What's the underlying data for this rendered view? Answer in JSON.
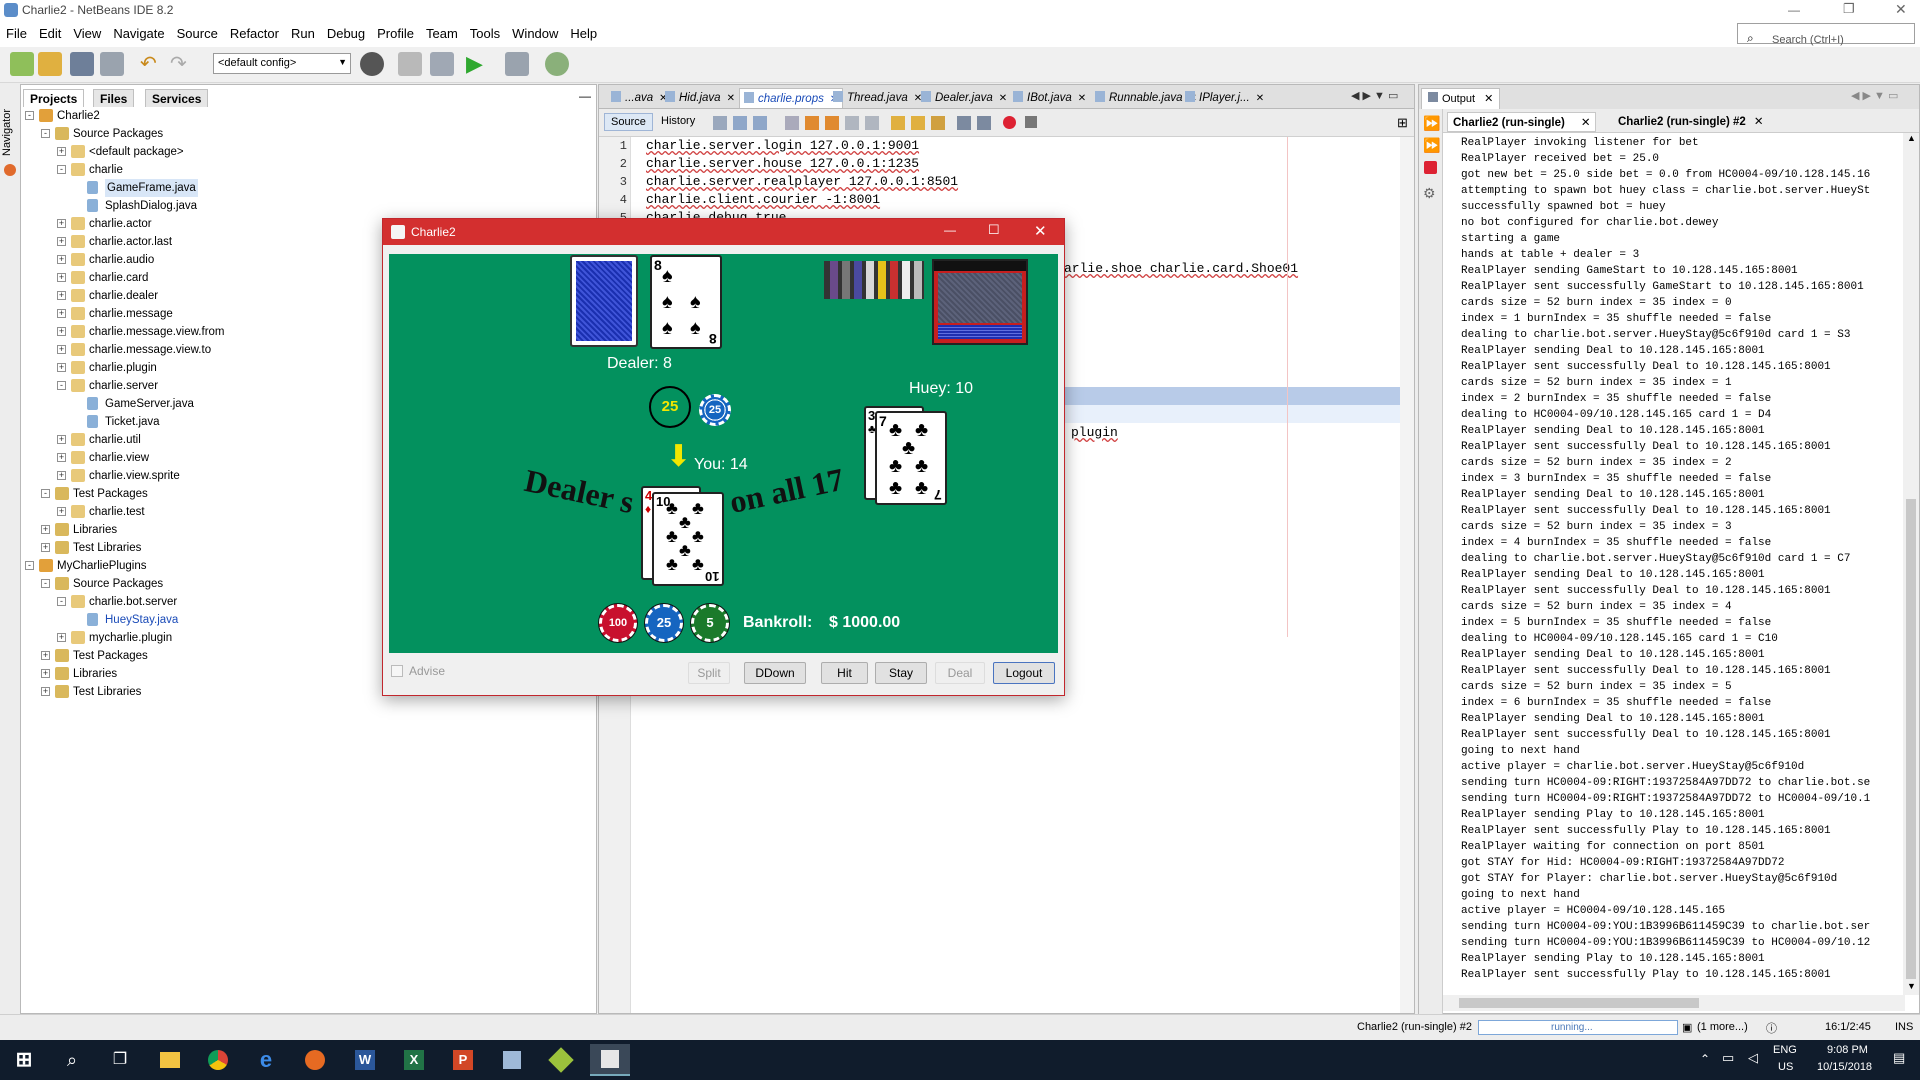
{
  "window": {
    "title": "Charlie2 - NetBeans IDE 8.2"
  },
  "search": {
    "placeholder": "Search (Ctrl+I)"
  },
  "menu": [
    "File",
    "Edit",
    "View",
    "Navigate",
    "Source",
    "Refactor",
    "Run",
    "Debug",
    "Profile",
    "Team",
    "Tools",
    "Window",
    "Help"
  ],
  "toolbar": {
    "config": "<default config>"
  },
  "navigator_label": "Navigator",
  "projects": {
    "tabs": [
      "Projects",
      "Files",
      "Services"
    ],
    "tree": [
      {
        "label": "Charlie2",
        "level": 0,
        "kind": "project",
        "exp": "-"
      },
      {
        "label": "Source Packages",
        "level": 1,
        "kind": "folder",
        "exp": "-"
      },
      {
        "label": "<default package>",
        "level": 2,
        "kind": "pkg",
        "exp": "+"
      },
      {
        "label": "charlie",
        "level": 2,
        "kind": "pkg",
        "exp": "-"
      },
      {
        "label": "GameFrame.java",
        "level": 3,
        "kind": "java",
        "exp": ""
      },
      {
        "label": "SplashDialog.java",
        "level": 3,
        "kind": "java",
        "exp": ""
      },
      {
        "label": "charlie.actor",
        "level": 2,
        "kind": "pkg",
        "exp": "+"
      },
      {
        "label": "charlie.actor.last",
        "level": 2,
        "kind": "pkg",
        "exp": "+"
      },
      {
        "label": "charlie.audio",
        "level": 2,
        "kind": "pkg",
        "exp": "+"
      },
      {
        "label": "charlie.card",
        "level": 2,
        "kind": "pkg",
        "exp": "+"
      },
      {
        "label": "charlie.dealer",
        "level": 2,
        "kind": "pkg",
        "exp": "+"
      },
      {
        "label": "charlie.message",
        "level": 2,
        "kind": "pkg",
        "exp": "+"
      },
      {
        "label": "charlie.message.view.from",
        "level": 2,
        "kind": "pkg",
        "exp": "+"
      },
      {
        "label": "charlie.message.view.to",
        "level": 2,
        "kind": "pkg",
        "exp": "+"
      },
      {
        "label": "charlie.plugin",
        "level": 2,
        "kind": "pkg",
        "exp": "+"
      },
      {
        "label": "charlie.server",
        "level": 2,
        "kind": "pkg",
        "exp": "-"
      },
      {
        "label": "GameServer.java",
        "level": 3,
        "kind": "java",
        "exp": ""
      },
      {
        "label": "Ticket.java",
        "level": 3,
        "kind": "java",
        "exp": ""
      },
      {
        "label": "charlie.util",
        "level": 2,
        "kind": "pkg",
        "exp": "+"
      },
      {
        "label": "charlie.view",
        "level": 2,
        "kind": "pkg",
        "exp": "+"
      },
      {
        "label": "charlie.view.sprite",
        "level": 2,
        "kind": "pkg",
        "exp": "+"
      },
      {
        "label": "Test Packages",
        "level": 1,
        "kind": "folder",
        "exp": "-"
      },
      {
        "label": "charlie.test",
        "level": 2,
        "kind": "pkg",
        "exp": "+"
      },
      {
        "label": "Libraries",
        "level": 1,
        "kind": "lib",
        "exp": "+"
      },
      {
        "label": "Test Libraries",
        "level": 1,
        "kind": "lib",
        "exp": "+"
      },
      {
        "label": "MyCharliePlugins",
        "level": 0,
        "kind": "project",
        "exp": "-"
      },
      {
        "label": "Source Packages",
        "level": 1,
        "kind": "folder",
        "exp": "-"
      },
      {
        "label": "charlie.bot.server",
        "level": 2,
        "kind": "pkg",
        "exp": "-"
      },
      {
        "label": "HueyStay.java",
        "level": 3,
        "kind": "java",
        "exp": "",
        "selected": true
      },
      {
        "label": "mycharlie.plugin",
        "level": 2,
        "kind": "pkg",
        "exp": "+"
      },
      {
        "label": "Test Packages",
        "level": 1,
        "kind": "folder",
        "exp": "+"
      },
      {
        "label": "Libraries",
        "level": 1,
        "kind": "lib",
        "exp": "+"
      },
      {
        "label": "Test Libraries",
        "level": 1,
        "kind": "lib",
        "exp": "+"
      }
    ]
  },
  "editor": {
    "tabs": [
      "...ava",
      "Hid.java",
      "charlie.props",
      "Thread.java",
      "Dealer.java",
      "IBot.java",
      "Runnable.java",
      "IPlayer.j..."
    ],
    "active_tab": "charlie.props",
    "source_label": "Source",
    "history_label": "History",
    "lines": [
      {
        "n": "1",
        "text": "charlie.server.login 127.0.0.1:9001"
      },
      {
        "n": "2",
        "text": "charlie.server.house 127.0.0.1:1235"
      },
      {
        "n": "3",
        "text": "charlie.server.realplayer 127.0.0.1:8501"
      },
      {
        "n": "4",
        "text": "charlie.client.courier -1:8001"
      },
      {
        "n": "5",
        "text": "charlie.debug true"
      }
    ],
    "fragment_shoe": "arlie.shoe charlie.card.Shoe01",
    "fragment_plugin": "plugin"
  },
  "output": {
    "title": "Output",
    "subtabs": [
      "Charlie2 (run-single)",
      "Charlie2 (run-single) #2"
    ],
    "lines": [
      "RealPlayer invoking listener for bet",
      "RealPlayer received bet = 25.0",
      "got new bet = 25.0 side bet = 0.0 from HC0004-09/10.128.145.16",
      "attempting to spawn bot huey class = charlie.bot.server.HueySt",
      "successfully spawned bot = huey",
      "no bot configured for charlie.bot.dewey",
      "starting a game",
      "hands at table + dealer = 3",
      "RealPlayer sending GameStart to 10.128.145.165:8001",
      "RealPlayer sent successfully GameStart to 10.128.145.165:8001",
      "cards size = 52 burn index = 35 index = 0",
      "index = 1 burnIndex = 35 shuffle needed = false",
      "dealing to charlie.bot.server.HueyStay@5c6f910d card 1 = S3",
      "RealPlayer sending Deal to 10.128.145.165:8001",
      "RealPlayer sent successfully Deal to 10.128.145.165:8001",
      "cards size = 52 burn index = 35 index = 1",
      "index = 2 burnIndex = 35 shuffle needed = false",
      "dealing to HC0004-09/10.128.145.165 card 1 = D4",
      "RealPlayer sending Deal to 10.128.145.165:8001",
      "RealPlayer sent successfully Deal to 10.128.145.165:8001",
      "cards size = 52 burn index = 35 index = 2",
      "index = 3 burnIndex = 35 shuffle needed = false",
      "RealPlayer sending Deal to 10.128.145.165:8001",
      "RealPlayer sent successfully Deal to 10.128.145.165:8001",
      "cards size = 52 burn index = 35 index = 3",
      "index = 4 burnIndex = 35 shuffle needed = false",
      "dealing to charlie.bot.server.HueyStay@5c6f910d card 1 = C7",
      "RealPlayer sending Deal to 10.128.145.165:8001",
      "RealPlayer sent successfully Deal to 10.128.145.165:8001",
      "cards size = 52 burn index = 35 index = 4",
      "index = 5 burnIndex = 35 shuffle needed = false",
      "dealing to HC0004-09/10.128.145.165 card 1 = C10",
      "RealPlayer sending Deal to 10.128.145.165:8001",
      "RealPlayer sent successfully Deal to 10.128.145.165:8001",
      "cards size = 52 burn index = 35 index = 5",
      "index = 6 burnIndex = 35 shuffle needed = false",
      "RealPlayer sending Deal to 10.128.145.165:8001",
      "RealPlayer sent successfully Deal to 10.128.145.165:8001",
      "going to next hand",
      "active player = charlie.bot.server.HueyStay@5c6f910d",
      "sending turn HC0004-09:RIGHT:19372584A97DD72 to charlie.bot.se",
      "sending turn HC0004-09:RIGHT:19372584A97DD72 to HC0004-09/10.1",
      "RealPlayer sending Play to 10.128.145.165:8001",
      "RealPlayer sent successfully Play to 10.128.145.165:8001",
      "RealPlayer waiting for connection on port 8501",
      "got STAY for Hid: HC0004-09:RIGHT:19372584A97DD72",
      "got STAY for Player: charlie.bot.server.HueyStay@5c6f910d",
      "going to next hand",
      "active player = HC0004-09/10.128.145.165",
      "sending turn HC0004-09:YOU:1B3996B611459C39 to charlie.bot.ser",
      "sending turn HC0004-09:YOU:1B3996B611459C39 to HC0004-09/10.12",
      "RealPlayer sending Play to 10.128.145.165:8001",
      "RealPlayer sent successfully Play to 10.128.145.165:8001"
    ]
  },
  "statusbar": {
    "run_label": "Charlie2 (run-single) #2",
    "progress_label": "running...",
    "more": "(1 more...)",
    "position": "16:1/2:45",
    "mode": "INS"
  },
  "taskbar": {
    "lang": "ENG",
    "region": "US",
    "time": "9:08 PM",
    "date": "10/15/2018"
  },
  "charlie": {
    "title": "Charlie2",
    "dealer_label": "Dealer: 8",
    "huey_label": "Huey: 10",
    "you_label": "You: 14",
    "table_text_left": "Dealer s",
    "table_text_right": "on all 17",
    "bet_chip": "25",
    "bet_stack_chip": "25",
    "chips": [
      {
        "value": "100",
        "color": "#c8102e"
      },
      {
        "value": "25",
        "color": "#1565c0"
      },
      {
        "value": "5",
        "color": "#1b7a2b"
      }
    ],
    "bankroll_label": "Bankroll:",
    "bankroll_value": "$ 1000.00",
    "cards": {
      "dealer_up": {
        "rank": "8",
        "suit": "♠"
      },
      "huey_1": {
        "rank": "3",
        "suit": "♣"
      },
      "huey_2": {
        "rank": "7",
        "suit": "♣"
      },
      "you_1": {
        "rank": "4",
        "suit": "♦"
      },
      "you_2": {
        "rank": "10",
        "suit": "♣"
      }
    },
    "advise_label": "Advise",
    "buttons": {
      "split": "Split",
      "ddown": "DDown",
      "hit": "Hit",
      "stay": "Stay",
      "deal": "Deal",
      "logout": "Logout"
    }
  },
  "colors": {
    "table": "#03915e",
    "accent": "#d32f2f",
    "bet_chip": "#f2e600",
    "taskbar": "#101c2c"
  }
}
